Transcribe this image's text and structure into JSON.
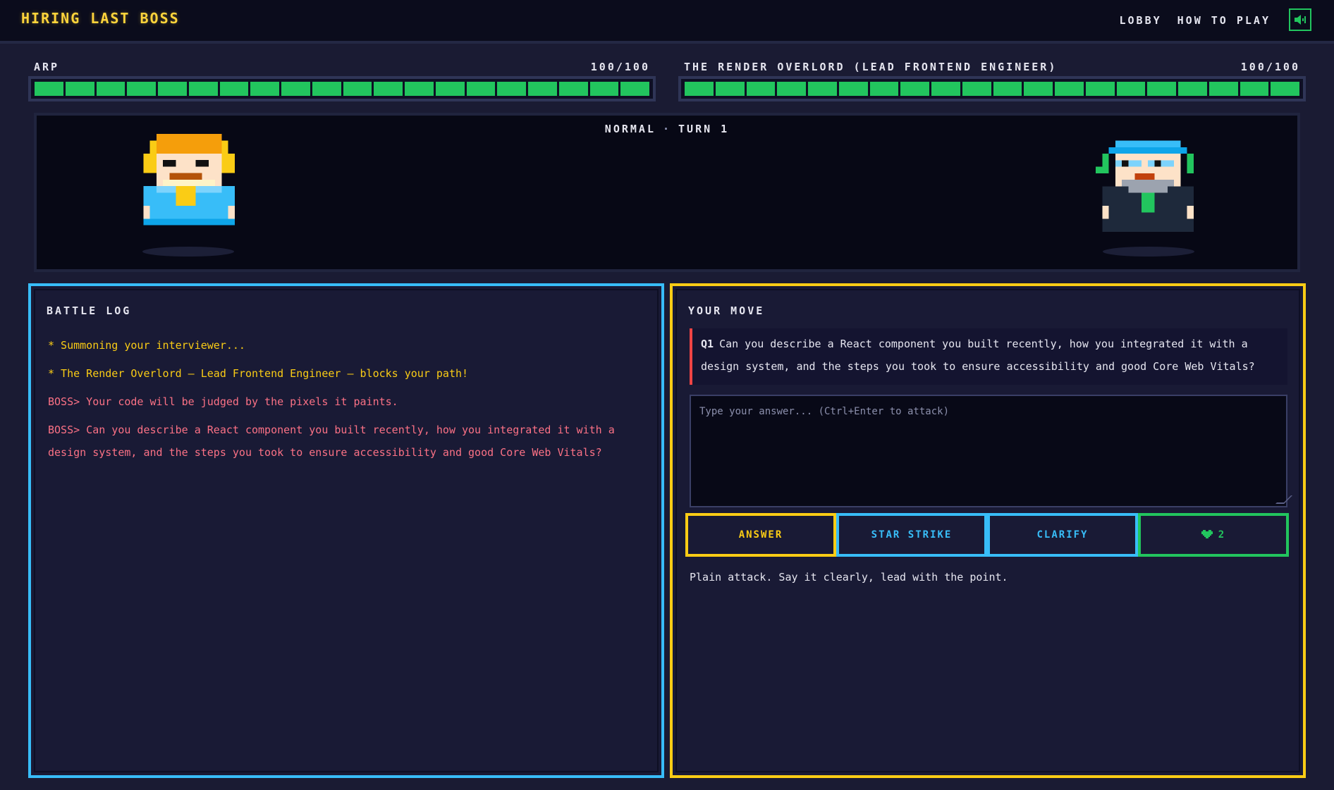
{
  "header": {
    "title": "HIRING LAST BOSS",
    "nav": [
      "LOBBY",
      "HOW TO PLAY"
    ],
    "sound_icon": "speaker-icon",
    "accent": "#ffd43b"
  },
  "player": {
    "name": "ARP",
    "hp_text": "100/100",
    "hp_fraction": 1.0,
    "hp_color": "#22c55e"
  },
  "boss": {
    "name": "THE RENDER OVERLORD (LEAD FRONTEND ENGINEER)",
    "hp_text": "100/100",
    "hp_fraction": 1.0,
    "hp_color": "#22c55e"
  },
  "arena": {
    "difficulty": "NORMAL",
    "separator": "·",
    "turn": "TURN 1"
  },
  "battle_log": {
    "title": "BATTLE LOG",
    "entries": [
      {
        "kind": "system",
        "text": "* Summoning your interviewer..."
      },
      {
        "kind": "system",
        "text": "* The Render Overlord – Lead Frontend Engineer – blocks your path!"
      },
      {
        "kind": "boss",
        "text": "BOSS> Your code will be judged by the pixels it paints."
      },
      {
        "kind": "boss",
        "text": "BOSS> Can you describe a React component you built recently, how you integrated it with a design system, and the steps you took to ensure accessibility and good Core Web Vitals?"
      }
    ]
  },
  "your_move": {
    "title": "YOUR MOVE",
    "question_tag": "Q1",
    "question": "Can you describe a React component you built recently, how you integrated it with a design system, and the steps you took to ensure accessibility and good Core Web Vitals?",
    "answer_placeholder": "Type your answer... (Ctrl+Enter to attack)",
    "answer_value": "",
    "actions": {
      "answer": "ANSWER",
      "star_strike": "STAR STRIKE",
      "clarify": "CLARIFY",
      "heal_count": "2",
      "heal_icon": "heart-icon"
    },
    "hint": "Plain attack. Say it clearly, lead with the point."
  },
  "colors": {
    "player_frame": "#38bdf8",
    "move_frame": "#facc15",
    "boss_text": "#fb7185",
    "system_text": "#facc15"
  }
}
